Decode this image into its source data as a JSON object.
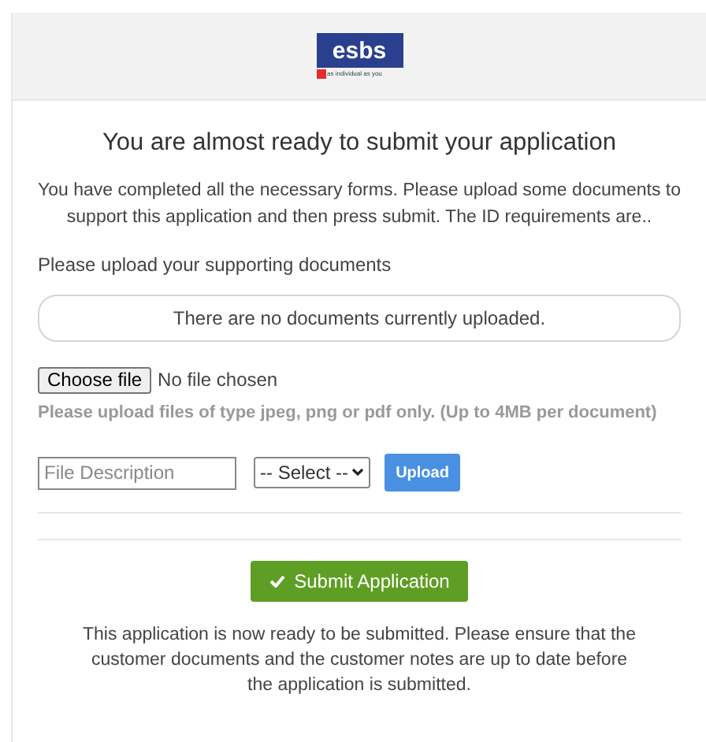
{
  "logo": {
    "name": "esbs",
    "tagline": "as individual as you"
  },
  "title": "You are almost ready to submit your application",
  "intro": "You have completed all the necessary forms. Please upload some documents to support this application and then press submit. The ID requirements are..",
  "upload_label": "Please upload your supporting documents",
  "documents_notice": "There are no documents currently uploaded.",
  "file_picker": {
    "button": "Choose file",
    "status": "No file chosen"
  },
  "file_hint": "Please upload files of type jpeg, png or pdf only. (Up to 4MB per document)",
  "description_field": {
    "placeholder": "File Description"
  },
  "type_select": {
    "value": "-- Select --"
  },
  "upload_button": "Upload",
  "submit_button": "Submit Application",
  "footer_note": "This application is now ready to be submitted. Please ensure that the customer documents and the customer notes are up to date before the application is submitted."
}
